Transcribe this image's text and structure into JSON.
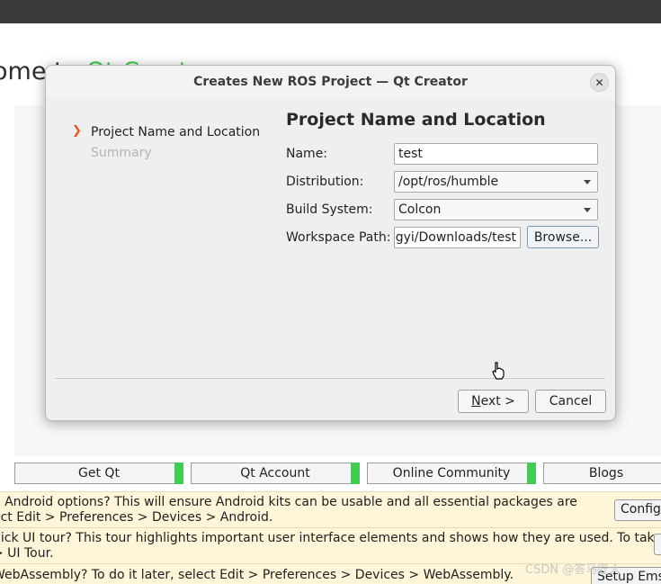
{
  "background": {
    "welcome_prefix": "ome to",
    "welcome_product": "Qt Creator",
    "accent_color": "#41cd52",
    "links": [
      "Get Qt",
      "Qt Account",
      "Online Community",
      "Blogs"
    ],
    "notices": [
      {
        "lines": [
          "e Android options? This will ensure Android kits can be usable and all essential packages are",
          "ect Edit > Preferences > Devices > Android."
        ],
        "button": "Config"
      },
      {
        "lines": [
          "uick UI tour? This tour highlights important user interface elements and shows how they are used. To take",
          "> UI Tour."
        ],
        "button": ""
      },
      {
        "lines": [
          "WebAssembly? To do it later, select Edit > Preferences > Devices > WebAssembly."
        ],
        "button": "Setup Ems"
      }
    ],
    "watermark": "CSDN @答马匠人"
  },
  "dialog": {
    "title": "Creates New ROS Project — Qt Creator",
    "close_icon": "close-icon",
    "steps": [
      {
        "label": "Project Name and Location",
        "current": true
      },
      {
        "label": "Summary",
        "current": false
      }
    ],
    "heading": "Project Name and Location",
    "form": {
      "name_label": "Name:",
      "name_value": "test",
      "distribution_label": "Distribution:",
      "distribution_value": "/opt/ros/humble",
      "build_label": "Build System:",
      "build_value": "Colcon",
      "workspace_label": "Workspace Path:",
      "workspace_value": "ngyi/Downloads/test",
      "browse_label": "Browse..."
    },
    "buttons": {
      "next_mnemonic": "N",
      "next_rest": "ext >",
      "cancel": "Cancel"
    }
  }
}
